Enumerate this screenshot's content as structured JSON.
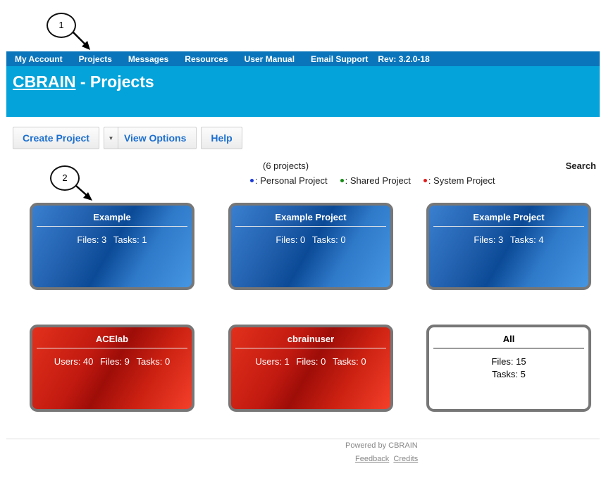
{
  "callouts": [
    "1",
    "2"
  ],
  "nav": {
    "items": [
      "My Account",
      "Projects",
      "Messages",
      "Resources",
      "User Manual",
      "Email Support"
    ],
    "rev": "Rev: 3.2.0-18"
  },
  "header": {
    "brand": "CBRAIN",
    "title_suffix": " - Projects"
  },
  "toolbar": {
    "create": "Create Project",
    "view_options": "View Options",
    "help": "Help"
  },
  "summary": {
    "count": "(6 projects)",
    "search": "Search"
  },
  "legend": [
    {
      "label": ": Personal Project",
      "color": "#1a3ad6"
    },
    {
      "label": ": Shared Project",
      "color": "#148a14"
    },
    {
      "label": ": System Project",
      "color": "#e01b1b"
    }
  ],
  "projects": [
    {
      "name": "Example",
      "stats": [
        "Files: 3",
        "Tasks: 1"
      ],
      "kind": "personal"
    },
    {
      "name": "Example Project",
      "stats": [
        "Files: 0",
        "Tasks: 0"
      ],
      "kind": "personal"
    },
    {
      "name": "Example Project",
      "stats": [
        "Files: 3",
        "Tasks: 4"
      ],
      "kind": "personal"
    },
    {
      "name": "ACElab",
      "stats": [
        "Users: 40",
        "Files: 9",
        "Tasks: 0"
      ],
      "kind": "system"
    },
    {
      "name": "cbrainuser",
      "stats": [
        "Users: 1",
        "Files: 0",
        "Tasks: 0"
      ],
      "kind": "system"
    },
    {
      "name": "All",
      "stats": [
        "Files: 15",
        "Tasks: 5"
      ],
      "kind": "all"
    }
  ],
  "footer": {
    "powered": "Powered by CBRAIN",
    "feedback": "Feedback",
    "credits": "Credits"
  }
}
